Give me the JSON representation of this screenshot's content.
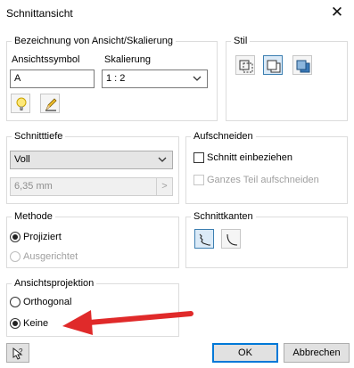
{
  "window": {
    "title": "Schnittansicht",
    "close_icon": "close-icon"
  },
  "designation": {
    "group_label": "Bezeichnung von Ansicht/Skalierung",
    "symbol_label": "Ansichtssymbol",
    "symbol_value": "A",
    "scale_label": "Skalierung",
    "scale_value": "1 : 2",
    "icons": [
      "lightbulb-icon",
      "pencil-icon"
    ]
  },
  "style": {
    "group_label": "Stil",
    "icons": [
      "hidden-lines-style-icon",
      "hidden-lines-removed-style-icon",
      "shaded-style-icon"
    ]
  },
  "depth": {
    "group_label": "Schnitttiefe",
    "value": "Voll",
    "distance_value": "6,35 mm"
  },
  "slice": {
    "group_label": "Aufschneiden",
    "include_slice": "Schnitt einbeziehen",
    "slice_whole": "Ganzes Teil aufschneiden"
  },
  "method": {
    "group_label": "Methode",
    "projected": "Projiziert",
    "aligned": "Ausgerichtet"
  },
  "edges": {
    "group_label": "Schnittkanten",
    "icons": [
      "smooth-cut-edges-icon",
      "default-cut-edges-icon"
    ]
  },
  "projection": {
    "group_label": "Ansichtsprojektion",
    "orthogonal": "Orthogonal",
    "none": "Keine"
  },
  "annotation_color": "#e02a2a",
  "footer": {
    "help_icon": "help-icon",
    "ok": "OK",
    "cancel": "Abbrechen"
  }
}
